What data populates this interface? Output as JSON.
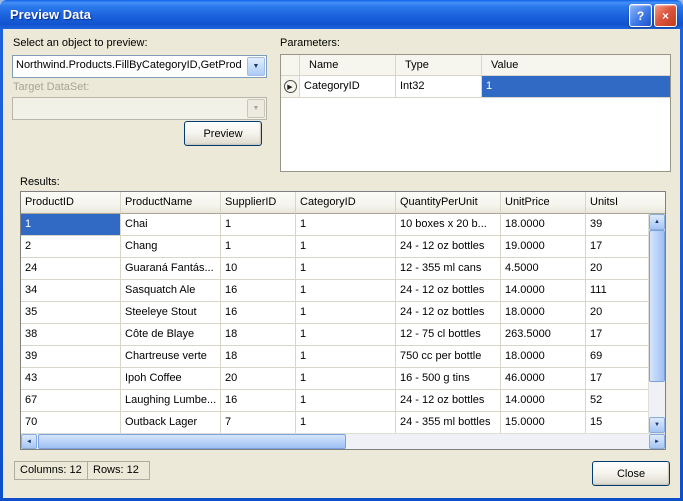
{
  "titlebar": {
    "title": "Preview Data",
    "help": "?",
    "close": "×"
  },
  "icons": {
    "dropdown": "▼",
    "up": "▲",
    "down": "▼",
    "left": "◄",
    "right": "►",
    "row_selector": "▶"
  },
  "selector": {
    "object_label": "Select an object to preview:",
    "object_value": "Northwind.Products.FillByCategoryID,GetProd",
    "dataset_label": "Target DataSet:",
    "dataset_value": "",
    "preview_button": "Preview"
  },
  "parameters": {
    "label": "Parameters:",
    "columns": [
      "Name",
      "Type",
      "Value"
    ],
    "row": {
      "name": "CategoryID",
      "type": "Int32",
      "value": "1"
    }
  },
  "results": {
    "label": "Results:",
    "columns": [
      "ProductID",
      "ProductName",
      "SupplierID",
      "CategoryID",
      "QuantityPerUnit",
      "UnitPrice",
      "UnitsI"
    ],
    "rows": [
      [
        "1",
        "Chai",
        "1",
        "1",
        "10 boxes x 20 b...",
        "18.0000",
        "39"
      ],
      [
        "2",
        "Chang",
        "1",
        "1",
        "24 - 12 oz bottles",
        "19.0000",
        "17"
      ],
      [
        "24",
        "Guaraná Fantás...",
        "10",
        "1",
        "12 - 355 ml cans",
        "4.5000",
        "20"
      ],
      [
        "34",
        "Sasquatch Ale",
        "16",
        "1",
        "24 - 12 oz bottles",
        "14.0000",
        "111"
      ],
      [
        "35",
        "Steeleye Stout",
        "16",
        "1",
        "24 - 12 oz bottles",
        "18.0000",
        "20"
      ],
      [
        "38",
        "Côte de Blaye",
        "18",
        "1",
        "12 - 75 cl bottles",
        "263.5000",
        "17"
      ],
      [
        "39",
        "Chartreuse verte",
        "18",
        "1",
        "750 cc per bottle",
        "18.0000",
        "69"
      ],
      [
        "43",
        "Ipoh Coffee",
        "20",
        "1",
        "16 - 500 g tins",
        "46.0000",
        "17"
      ],
      [
        "67",
        "Laughing Lumbe...",
        "16",
        "1",
        "24 - 12 oz bottles",
        "14.0000",
        "52"
      ],
      [
        "70",
        "Outback Lager",
        "7",
        "1",
        "24 - 355 ml bottles",
        "15.0000",
        "15"
      ]
    ],
    "selected_cell": {
      "row": 0,
      "col": 0
    }
  },
  "statusbar": {
    "columns": "Columns: 12",
    "rows": "Rows: 12"
  },
  "footer": {
    "close_button": "Close"
  }
}
